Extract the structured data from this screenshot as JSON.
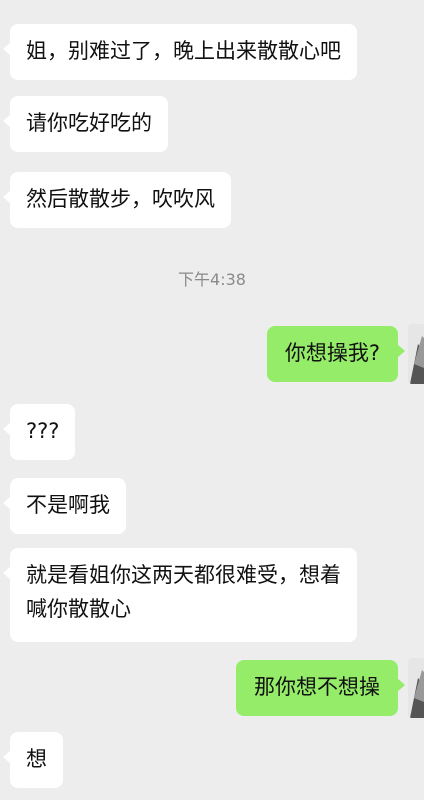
{
  "messages": [
    {
      "side": "recv",
      "text": "姐，别难过了，晚上出来散散心吧"
    },
    {
      "side": "recv",
      "text": "请你吃好吃的"
    },
    {
      "side": "recv",
      "text": "然后散散步，吹吹风"
    },
    {
      "side": "sent",
      "text": "你想操我?"
    },
    {
      "side": "recv",
      "text": "???"
    },
    {
      "side": "recv",
      "text": "不是啊我"
    },
    {
      "side": "recv",
      "text": "就是看姐你这两天都很难受，想着\n喊你散散心"
    },
    {
      "side": "sent",
      "text": "那你想不想操"
    },
    {
      "side": "recv",
      "text": "想"
    }
  ],
  "timestamp": "下午4:38",
  "colors": {
    "background": "#ededed",
    "received_bubble": "#ffffff",
    "sent_bubble": "#95ec69",
    "timestamp_text": "#8a8a8a"
  },
  "icons": {
    "my_avatar": "avatar-icon"
  }
}
